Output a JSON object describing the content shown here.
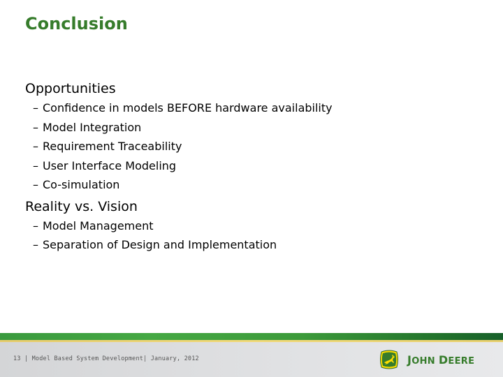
{
  "slide": {
    "title": "Conclusion",
    "sections": [
      {
        "heading": "Opportunities",
        "bullets": [
          "Confidence in models BEFORE hardware availability",
          "Model Integration",
          "Requirement Traceability",
          "User Interface Modeling",
          "Co-simulation"
        ]
      },
      {
        "heading": "Reality vs. Vision",
        "bullets": [
          "Model Management",
          "Separation of Design and Implementation"
        ]
      }
    ],
    "bullet_marker": "–"
  },
  "footer": {
    "text": "13 | Model Based System Development| January, 2012",
    "logo": {
      "icon": "leaping-deer-icon",
      "first_initial": "J",
      "first_rest": "OHN",
      "second_initial": "D",
      "second_rest": "EERE"
    }
  },
  "colors": {
    "brand_green": "#367c2b",
    "brand_yellow": "#ffde00"
  }
}
